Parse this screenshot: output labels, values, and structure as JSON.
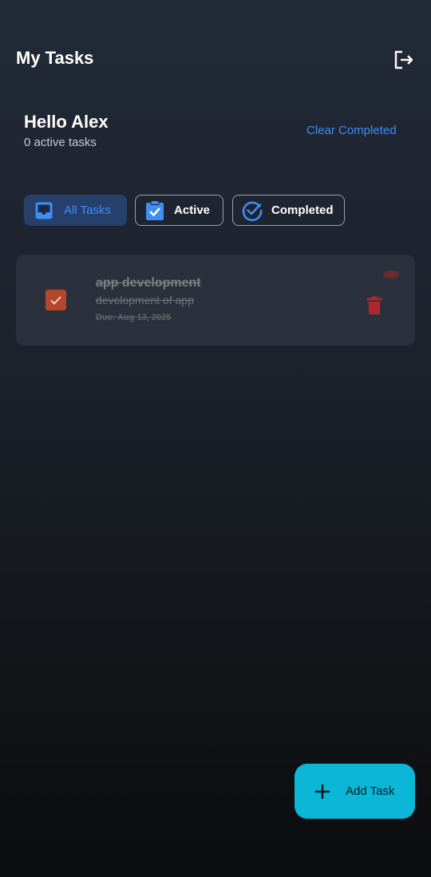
{
  "app_bar": {
    "title": "My Tasks",
    "logout_icon": "logout-icon"
  },
  "header": {
    "greeting": "Hello Alex",
    "active_count": "0 active tasks",
    "clear_label": "Clear Completed"
  },
  "filters": {
    "selected": "All Tasks",
    "items": [
      {
        "label": "All Tasks",
        "icon": "inbox-icon"
      },
      {
        "label": "Active",
        "icon": "clipboard-check-icon"
      },
      {
        "label": "Completed",
        "icon": "check-circle-icon"
      }
    ]
  },
  "tasks": [
    {
      "title": "app development",
      "description": "development of app",
      "due": "Due: Aug 13, 2025",
      "completed": true,
      "check_icon": "checkmark-icon",
      "delete_icon": "trash-icon"
    }
  ],
  "fab": {
    "label": "Add Task",
    "icon": "plus-icon"
  },
  "colors": {
    "accent": "#3d8ef5",
    "fab": "#0cb6d6",
    "checkbox": "#b4472b",
    "delete": "#b0262e",
    "card": "#2b313c"
  }
}
